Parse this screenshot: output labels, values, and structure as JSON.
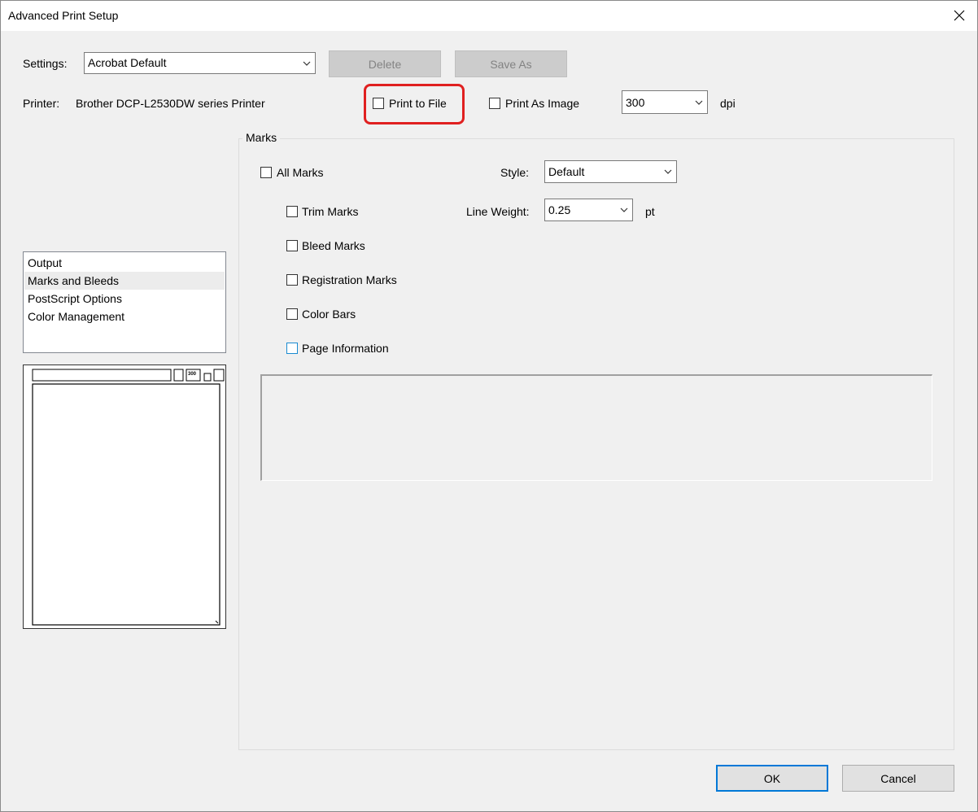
{
  "window": {
    "title": "Advanced Print Setup"
  },
  "settings": {
    "label": "Settings:",
    "value": "Acrobat Default",
    "delete_label": "Delete",
    "save_as_label": "Save As"
  },
  "printer": {
    "label": "Printer:",
    "name": "Brother DCP-L2530DW series Printer",
    "print_to_file": {
      "label": "Print to File",
      "checked": false
    },
    "print_as_image": {
      "label": "Print As Image",
      "checked": false
    },
    "dpi_value": "300",
    "dpi_unit": "dpi"
  },
  "sidebar": {
    "items": [
      {
        "label": "Output",
        "selected": false
      },
      {
        "label": "Marks and Bleeds",
        "selected": true
      },
      {
        "label": "PostScript Options",
        "selected": false
      },
      {
        "label": "Color Management",
        "selected": false
      }
    ],
    "preview": {
      "size_label": "300"
    }
  },
  "marks": {
    "group_title": "Marks",
    "all_marks": {
      "label": "All Marks",
      "checked": false
    },
    "style": {
      "label": "Style:",
      "value": "Default"
    },
    "line_weight": {
      "label": "Line Weight:",
      "value": "0.25",
      "unit": "pt"
    },
    "items": [
      {
        "label": "Trim Marks",
        "checked": false
      },
      {
        "label": "Bleed Marks",
        "checked": false
      },
      {
        "label": "Registration Marks",
        "checked": false
      },
      {
        "label": "Color Bars",
        "checked": false
      },
      {
        "label": "Page Information",
        "checked": false
      }
    ]
  },
  "footer": {
    "ok_label": "OK",
    "cancel_label": "Cancel"
  },
  "colors": {
    "highlight": "#e02020",
    "focus": "#0078d7"
  }
}
